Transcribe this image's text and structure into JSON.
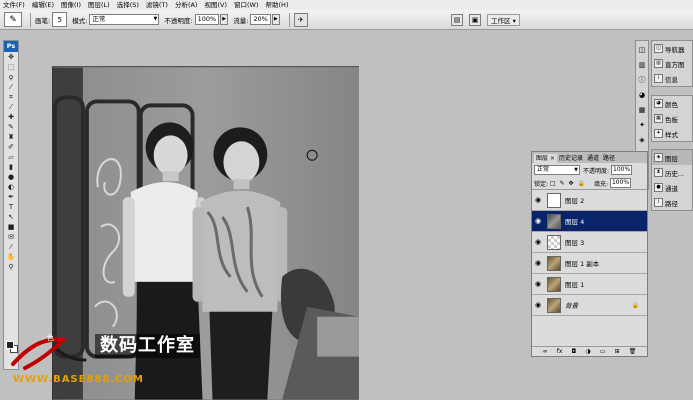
{
  "menu": [
    "文件(F)",
    "编辑(E)",
    "图像(I)",
    "图层(L)",
    "选择(S)",
    "滤镜(T)",
    "分析(A)",
    "视图(V)",
    "窗口(W)",
    "帮助(H)"
  ],
  "options_bar": {
    "brush_label": "画笔:",
    "brush_size": "5",
    "mode_label": "模式:",
    "mode_value": "正常",
    "opacity_label": "不透明度:",
    "opacity_value": "100%",
    "flow_label": "流量:",
    "flow_value": "20%",
    "workspace_label": "工作区 ▾"
  },
  "toolbox": {
    "logo": "Ps",
    "tools": [
      "move-icon",
      "marquee-icon",
      "lasso-icon",
      "magic-wand-icon",
      "crop-icon",
      "eyedropper-icon",
      "healing-icon",
      "brush-icon",
      "stamp-icon",
      "history-brush-icon",
      "eraser-icon",
      "gradient-icon",
      "blur-icon",
      "dodge-icon",
      "pen-icon",
      "type-icon",
      "path-select-icon",
      "shape-icon",
      "notes-icon",
      "eyedropper2-icon",
      "hand-icon",
      "zoom-icon"
    ]
  },
  "dock": {
    "group1": [
      "导航器",
      "直方图",
      "信息"
    ],
    "group2": [
      "颜色",
      "色板",
      "样式"
    ],
    "group3": [
      "图层",
      "历史...",
      "通道",
      "路径"
    ]
  },
  "layers_panel": {
    "tabs": [
      "图层 ×",
      "历史记录",
      "通道",
      "路径"
    ],
    "blend_mode": "正常",
    "opacity_label": "不透明度:",
    "opacity_value": "100%",
    "lock_label": "锁定:",
    "fill_label": "填充:",
    "fill_value": "100%",
    "layers": [
      {
        "name": "图层 2",
        "thumb": "white",
        "selected": false,
        "locked": false
      },
      {
        "name": "图层 4",
        "thumb": "photo",
        "selected": true,
        "locked": false
      },
      {
        "name": "图层 3",
        "thumb": "checker",
        "selected": false,
        "locked": false
      },
      {
        "name": "图层 1 副本",
        "thumb": "sepia",
        "selected": false,
        "locked": false
      },
      {
        "name": "图层 1",
        "thumb": "sepia",
        "selected": false,
        "locked": false
      },
      {
        "name": "背景",
        "thumb": "sepia",
        "selected": false,
        "locked": true
      }
    ]
  },
  "watermark": {
    "logo_text": "色",
    "studio_name": "数码工作室",
    "url": "WWW.BASE888.COM"
  }
}
